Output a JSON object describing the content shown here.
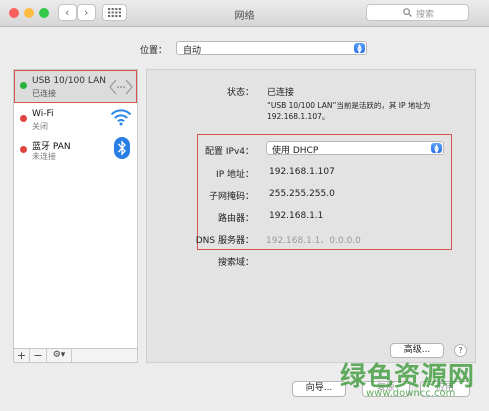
{
  "window": {
    "title": "网络",
    "search_placeholder": "搜索"
  },
  "location": {
    "label": "位置：",
    "value": "自动"
  },
  "services": [
    {
      "name": "USB 10/100 LAN",
      "status": "已连接",
      "status_color": "#27b33a",
      "icon": "ethernet-arrows-icon"
    },
    {
      "name": "Wi-Fi",
      "status": "关闭",
      "status_color": "#e0443e",
      "icon": "wifi-icon"
    },
    {
      "name": "蓝牙 PAN",
      "status": "未连接",
      "status_color": "#e0443e",
      "icon": "bluetooth-icon"
    }
  ],
  "sidebar_buttons": {
    "add": "+",
    "remove": "−",
    "gear": "⚙▾"
  },
  "detail": {
    "status_label": "状态：",
    "status_value": "已连接",
    "status_desc_line1": "“USB 10/100 LAN”当前是活跃的，其 IP 地址为",
    "status_desc_line2": "192.168.1.107。",
    "config_label": "配置 IPv4：",
    "config_value": "使用 DHCP",
    "ip_label": "IP 地址：",
    "ip_value": "192.168.1.107",
    "mask_label": "子网掩码：",
    "mask_value": "255.255.255.0",
    "router_label": "路由器：",
    "router_value": "192.168.1.1",
    "dns_label": "DNS 服务器：",
    "dns_value": "192.168.1.1、0.0.0.0",
    "search_domain_label": "搜索域："
  },
  "buttons": {
    "advanced": "高级...",
    "help": "?",
    "assistant": "向导...",
    "revert": "复原",
    "apply": "应用"
  },
  "watermark": {
    "text": "绿色资源网",
    "url": "www.downcc.com"
  },
  "colors": {
    "accent": "#2a6fe6",
    "highlight_border": "#d9534f",
    "connected": "#27b33a",
    "disconnected": "#e0443e"
  }
}
